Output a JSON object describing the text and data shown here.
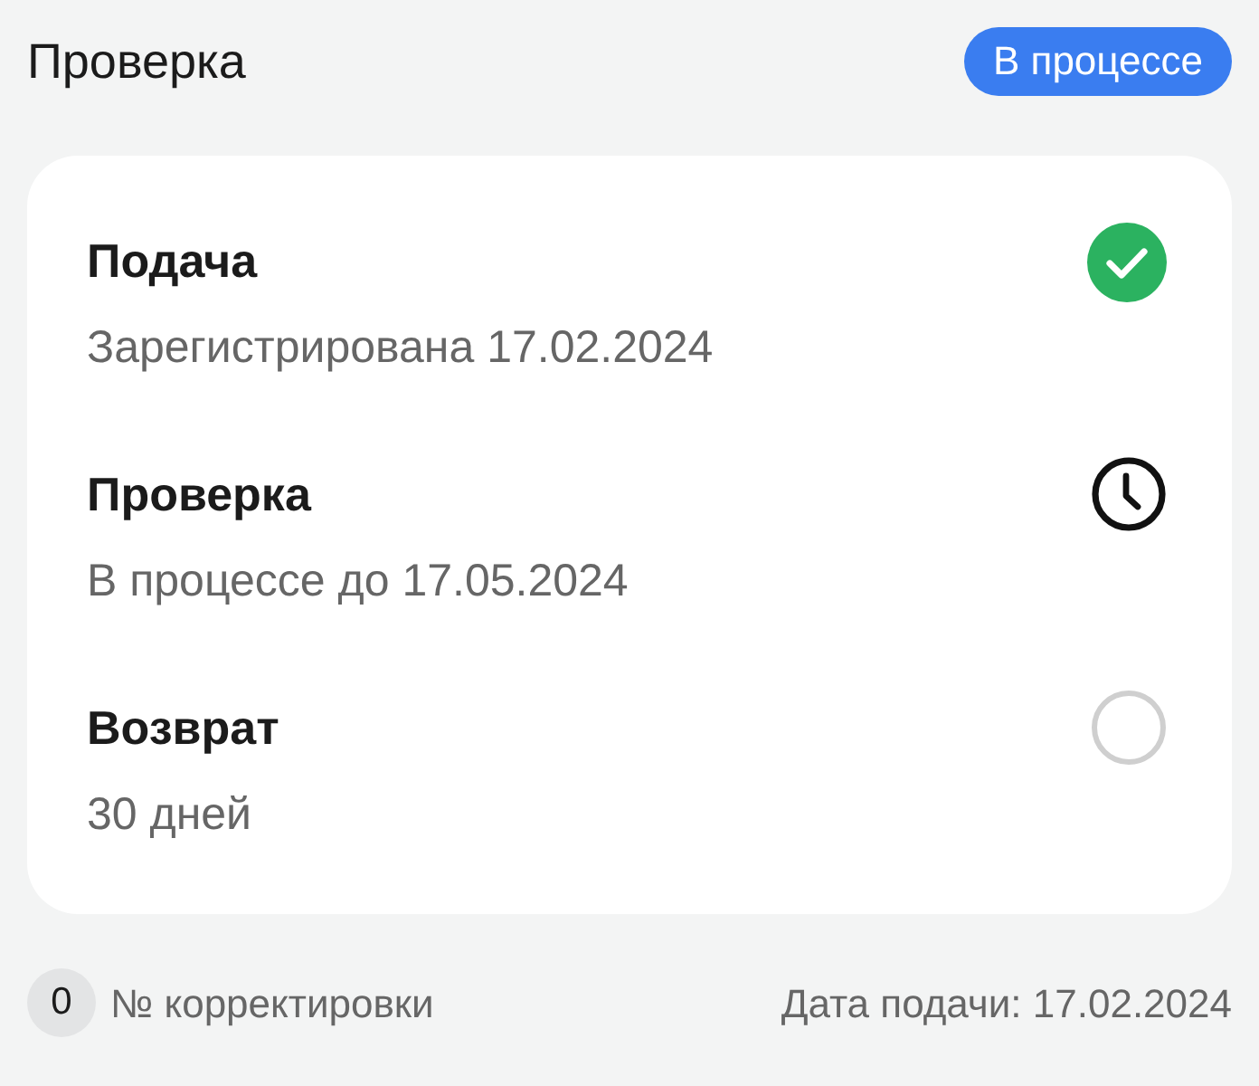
{
  "header": {
    "title": "Проверка",
    "status_badge": "В процессе"
  },
  "steps": [
    {
      "title": "Подача",
      "detail": "Зарегистрирована 17.02.2024",
      "kind": "done"
    },
    {
      "title": "Проверка",
      "detail": "В процессе до 17.05.2024",
      "kind": "active"
    },
    {
      "title": "Возврат",
      "detail": "30 дней",
      "kind": "pending"
    }
  ],
  "footer": {
    "correction_number": "0",
    "correction_label": "№ корректировки",
    "submission_date": "Дата подачи: 17.02.2024"
  }
}
